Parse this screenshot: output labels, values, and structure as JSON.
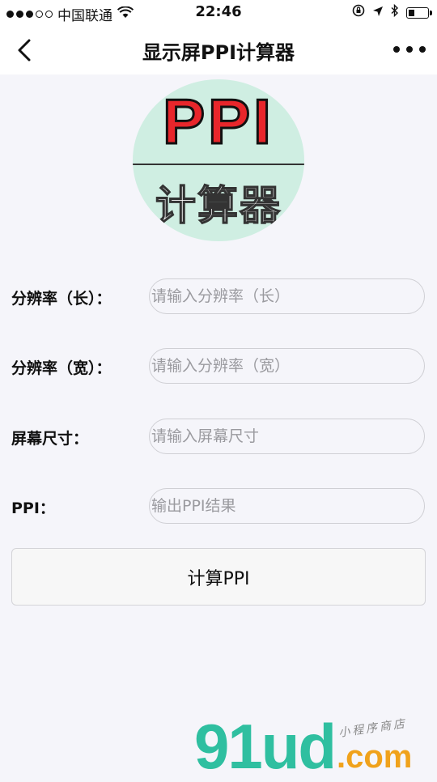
{
  "status_bar": {
    "carrier": "中国联通",
    "time": "22:46",
    "battery_level": 0.35
  },
  "nav": {
    "title": "显示屏PPI计算器"
  },
  "logo": {
    "top_text": "PPI",
    "bottom_text": "计算器"
  },
  "form": {
    "width": {
      "label": "分辨率（长）：",
      "placeholder": "请输入分辨率（长）"
    },
    "height": {
      "label": "分辨率（宽）：",
      "placeholder": "请输入分辨率（宽）"
    },
    "size": {
      "label": "屏幕尺寸：",
      "placeholder": "请输入屏幕尺寸"
    },
    "ppi": {
      "label": "PPI：",
      "placeholder": "输出PPI结果"
    }
  },
  "calc_button": {
    "label": "计算PPI"
  },
  "watermark": {
    "main": "91ud",
    "suffix": ".com",
    "tag": "小程序商店"
  },
  "colors": {
    "accent_red": "#e8262b",
    "logo_bg": "#cfeee2",
    "watermark_green": "#2fbfa0",
    "watermark_orange": "#f0a21b"
  }
}
